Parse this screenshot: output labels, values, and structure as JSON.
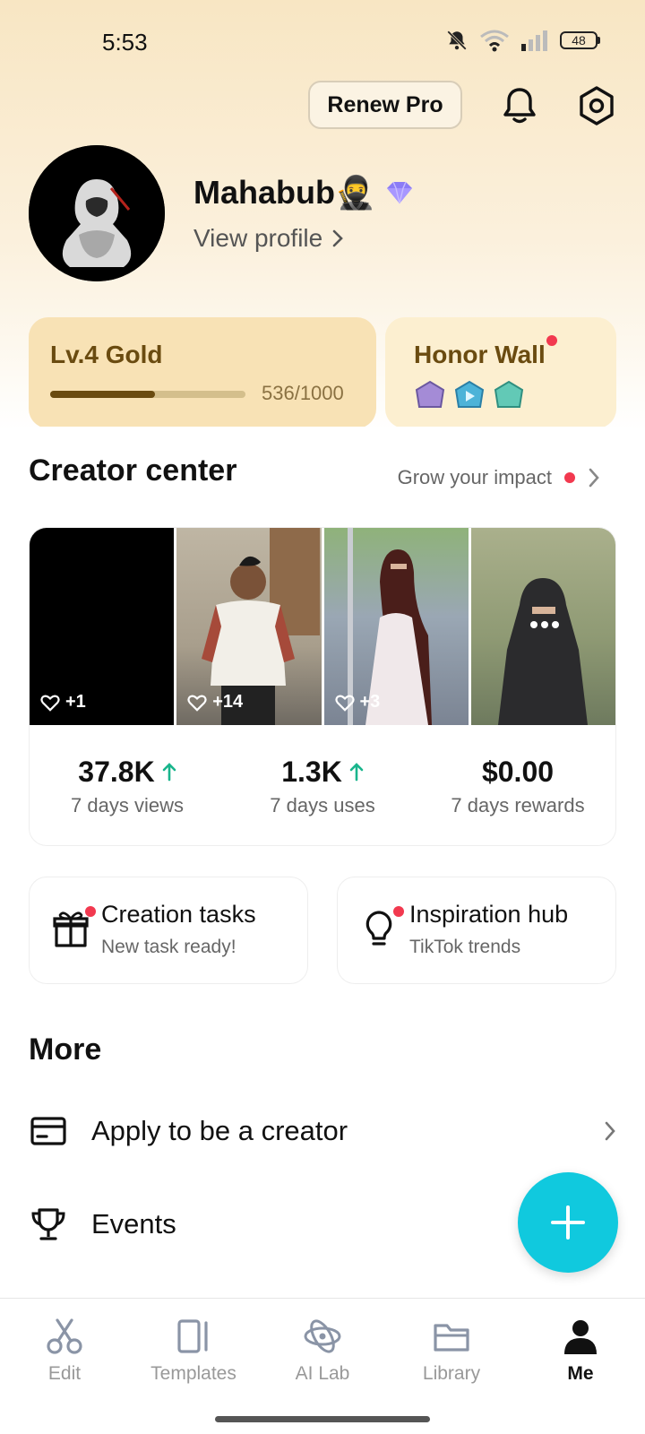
{
  "status_bar": {
    "time": "5:53",
    "battery": "48"
  },
  "header": {
    "renew_label": "Renew Pro"
  },
  "profile": {
    "name": "Mahabub🥷",
    "view_profile": "View profile"
  },
  "level": {
    "title": "Lv.4 Gold",
    "progress_text": "536/1000",
    "progress_fraction": 0.536
  },
  "honor": {
    "title": "Honor Wall"
  },
  "creator_center": {
    "title": "Creator center",
    "grow_label": "Grow your impact",
    "videos": [
      {
        "likes": "+1"
      },
      {
        "likes": "+14"
      },
      {
        "likes": "+3"
      },
      {
        "likes": ""
      }
    ],
    "stats": [
      {
        "value": "37.8K",
        "label": "7 days views",
        "trend": "up"
      },
      {
        "value": "1.3K",
        "label": "7 days uses",
        "trend": "up"
      },
      {
        "value": "$0.00",
        "label": "7 days rewards",
        "trend": "none"
      }
    ]
  },
  "tasks": [
    {
      "title": "Creation tasks",
      "subtitle": "New task ready!",
      "icon": "gift-icon"
    },
    {
      "title": "Inspiration hub",
      "subtitle": "TikTok trends",
      "icon": "lightbulb-icon"
    }
  ],
  "more": {
    "title": "More",
    "items": [
      {
        "label": "Apply to be a creator",
        "icon": "card-icon"
      },
      {
        "label": "Events",
        "icon": "trophy-icon"
      }
    ]
  },
  "nav": {
    "items": [
      {
        "label": "Edit",
        "icon": "scissors-icon"
      },
      {
        "label": "Templates",
        "icon": "templates-icon"
      },
      {
        "label": "AI Lab",
        "icon": "ai-lab-icon"
      },
      {
        "label": "Library",
        "icon": "folder-icon"
      },
      {
        "label": "Me",
        "icon": "person-icon",
        "active": true
      }
    ]
  },
  "colors": {
    "accent": "#10c9de",
    "gold": "#6a4b10",
    "notification": "#f2394f",
    "trend_up": "#19b58c"
  }
}
